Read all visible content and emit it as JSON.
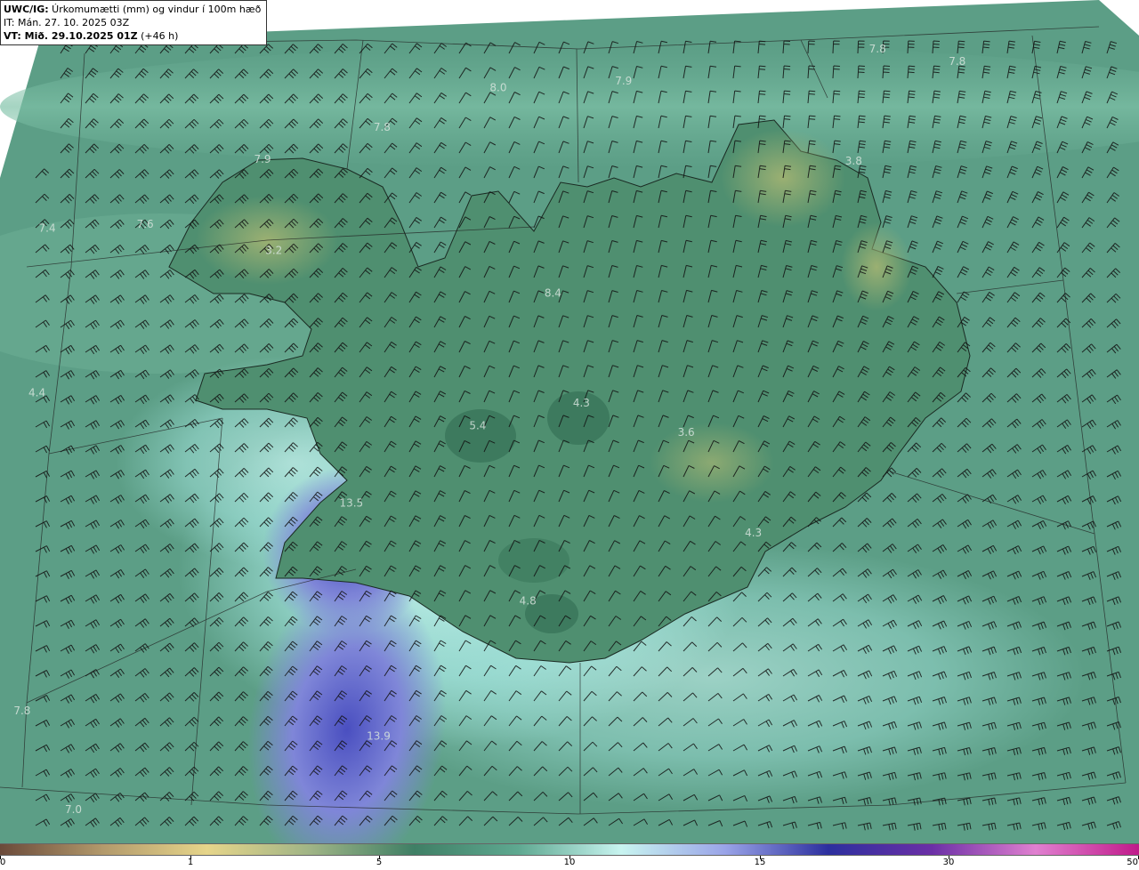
{
  "header": {
    "title_prefix": "UWC/IG:",
    "title_text": " Úrkomumætti (mm) og vindur í 100m hæð",
    "it_line": "IT: Mán. 27. 10. 2025 03Z",
    "vt_bold": "VT: Mið. 29.10.2025 01Z",
    "vt_rest": " (+46 h)"
  },
  "map_labels": [
    {
      "text": "7.8",
      "lon": 0.763,
      "lat": 0.062
    },
    {
      "text": "7.8",
      "lon": 0.833,
      "lat": 0.077
    },
    {
      "text": "7.9",
      "lon": 0.54,
      "lat": 0.1
    },
    {
      "text": "8.0",
      "lon": 0.43,
      "lat": 0.108
    },
    {
      "text": "7.8",
      "lon": 0.328,
      "lat": 0.155
    },
    {
      "text": "7.9",
      "lon": 0.223,
      "lat": 0.193
    },
    {
      "text": "3.8",
      "lon": 0.742,
      "lat": 0.195
    },
    {
      "text": "7.4",
      "lon": 0.034,
      "lat": 0.275
    },
    {
      "text": "7.6",
      "lon": 0.12,
      "lat": 0.27
    },
    {
      "text": "3.2",
      "lon": 0.233,
      "lat": 0.301
    },
    {
      "text": "8.4",
      "lon": 0.478,
      "lat": 0.352
    },
    {
      "text": "4.4",
      "lon": 0.025,
      "lat": 0.47
    },
    {
      "text": "4.3",
      "lon": 0.503,
      "lat": 0.482
    },
    {
      "text": "5.4",
      "lon": 0.412,
      "lat": 0.509
    },
    {
      "text": "3.6",
      "lon": 0.595,
      "lat": 0.517
    },
    {
      "text": "13.5",
      "lon": 0.298,
      "lat": 0.601
    },
    {
      "text": "4.3",
      "lon": 0.654,
      "lat": 0.636
    },
    {
      "text": "4.8",
      "lon": 0.456,
      "lat": 0.717
    },
    {
      "text": "7.8",
      "lon": 0.012,
      "lat": 0.847
    },
    {
      "text": "13.9",
      "lon": 0.322,
      "lat": 0.877
    },
    {
      "text": "7.0",
      "lon": 0.057,
      "lat": 0.964
    }
  ],
  "colors": {
    "land_high": "#8aa66b",
    "land_mid": "#4f8f70",
    "sea": "#5c9e86",
    "precip_light": "#bfeee8",
    "precip_heavy": "#4a4fc0"
  },
  "colorbar": {
    "stops": [
      "#6b4a3a",
      "#b39a6c",
      "#e6d58a",
      "#9fb486",
      "#3f7f65",
      "#5ea890",
      "#c8f4f0",
      "#9aa4e8",
      "#2c2f9e",
      "#6b2fa6",
      "#e080d0",
      "#c01a8a"
    ],
    "ticks": [
      {
        "label": "0",
        "pos": 0.0
      },
      {
        "label": "1",
        "pos": 0.167
      },
      {
        "label": "5",
        "pos": 0.333
      },
      {
        "label": "10",
        "pos": 0.5
      },
      {
        "label": "15",
        "pos": 0.667
      },
      {
        "label": "30",
        "pos": 0.833
      },
      {
        "label": "50",
        "pos": 1.0
      }
    ]
  }
}
